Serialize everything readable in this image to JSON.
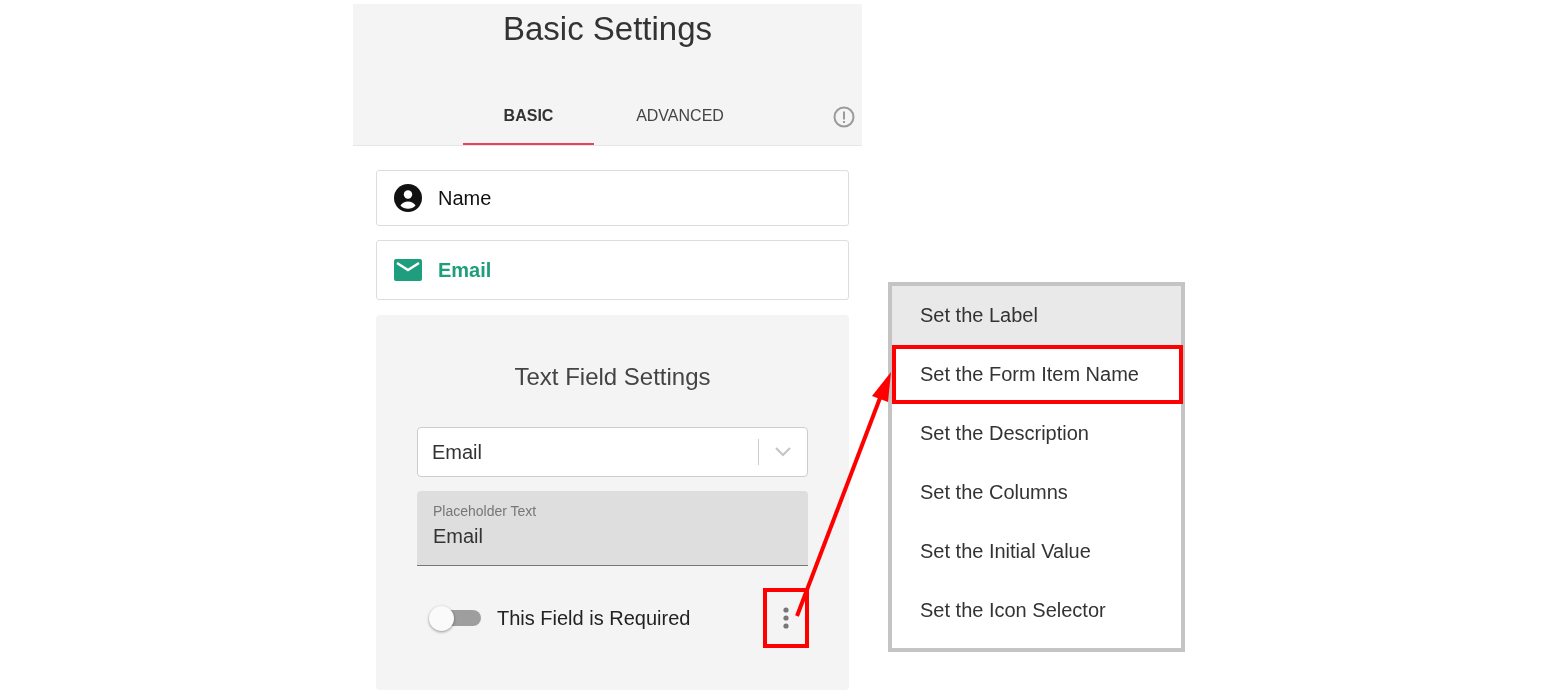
{
  "header": {
    "title": "Basic Settings"
  },
  "tabs": [
    {
      "label": "BASIC",
      "selected": true
    },
    {
      "label": "ADVANCED",
      "selected": false
    }
  ],
  "form_items": [
    {
      "label": "Name",
      "kind": "person",
      "selected": false
    },
    {
      "label": "Email",
      "kind": "mail",
      "selected": true
    }
  ],
  "settings_card": {
    "title": "Text Field Settings",
    "select_value": "Email",
    "placeholder_field": {
      "label": "Placeholder Text",
      "value": "Email"
    },
    "required_toggle": {
      "label": "This Field is Required",
      "on": false
    },
    "more_button_annotated": true
  },
  "menu": {
    "items": [
      {
        "label": "Set the Label",
        "hovered": true,
        "annotated": false
      },
      {
        "label": "Set the Form Item Name",
        "hovered": false,
        "annotated": true
      },
      {
        "label": "Set the Description",
        "hovered": false,
        "annotated": false
      },
      {
        "label": "Set the Columns",
        "hovered": false,
        "annotated": false
      },
      {
        "label": "Set the Initial Value",
        "hovered": false,
        "annotated": false
      },
      {
        "label": "Set the Icon Selector",
        "hovered": false,
        "annotated": false
      }
    ]
  }
}
